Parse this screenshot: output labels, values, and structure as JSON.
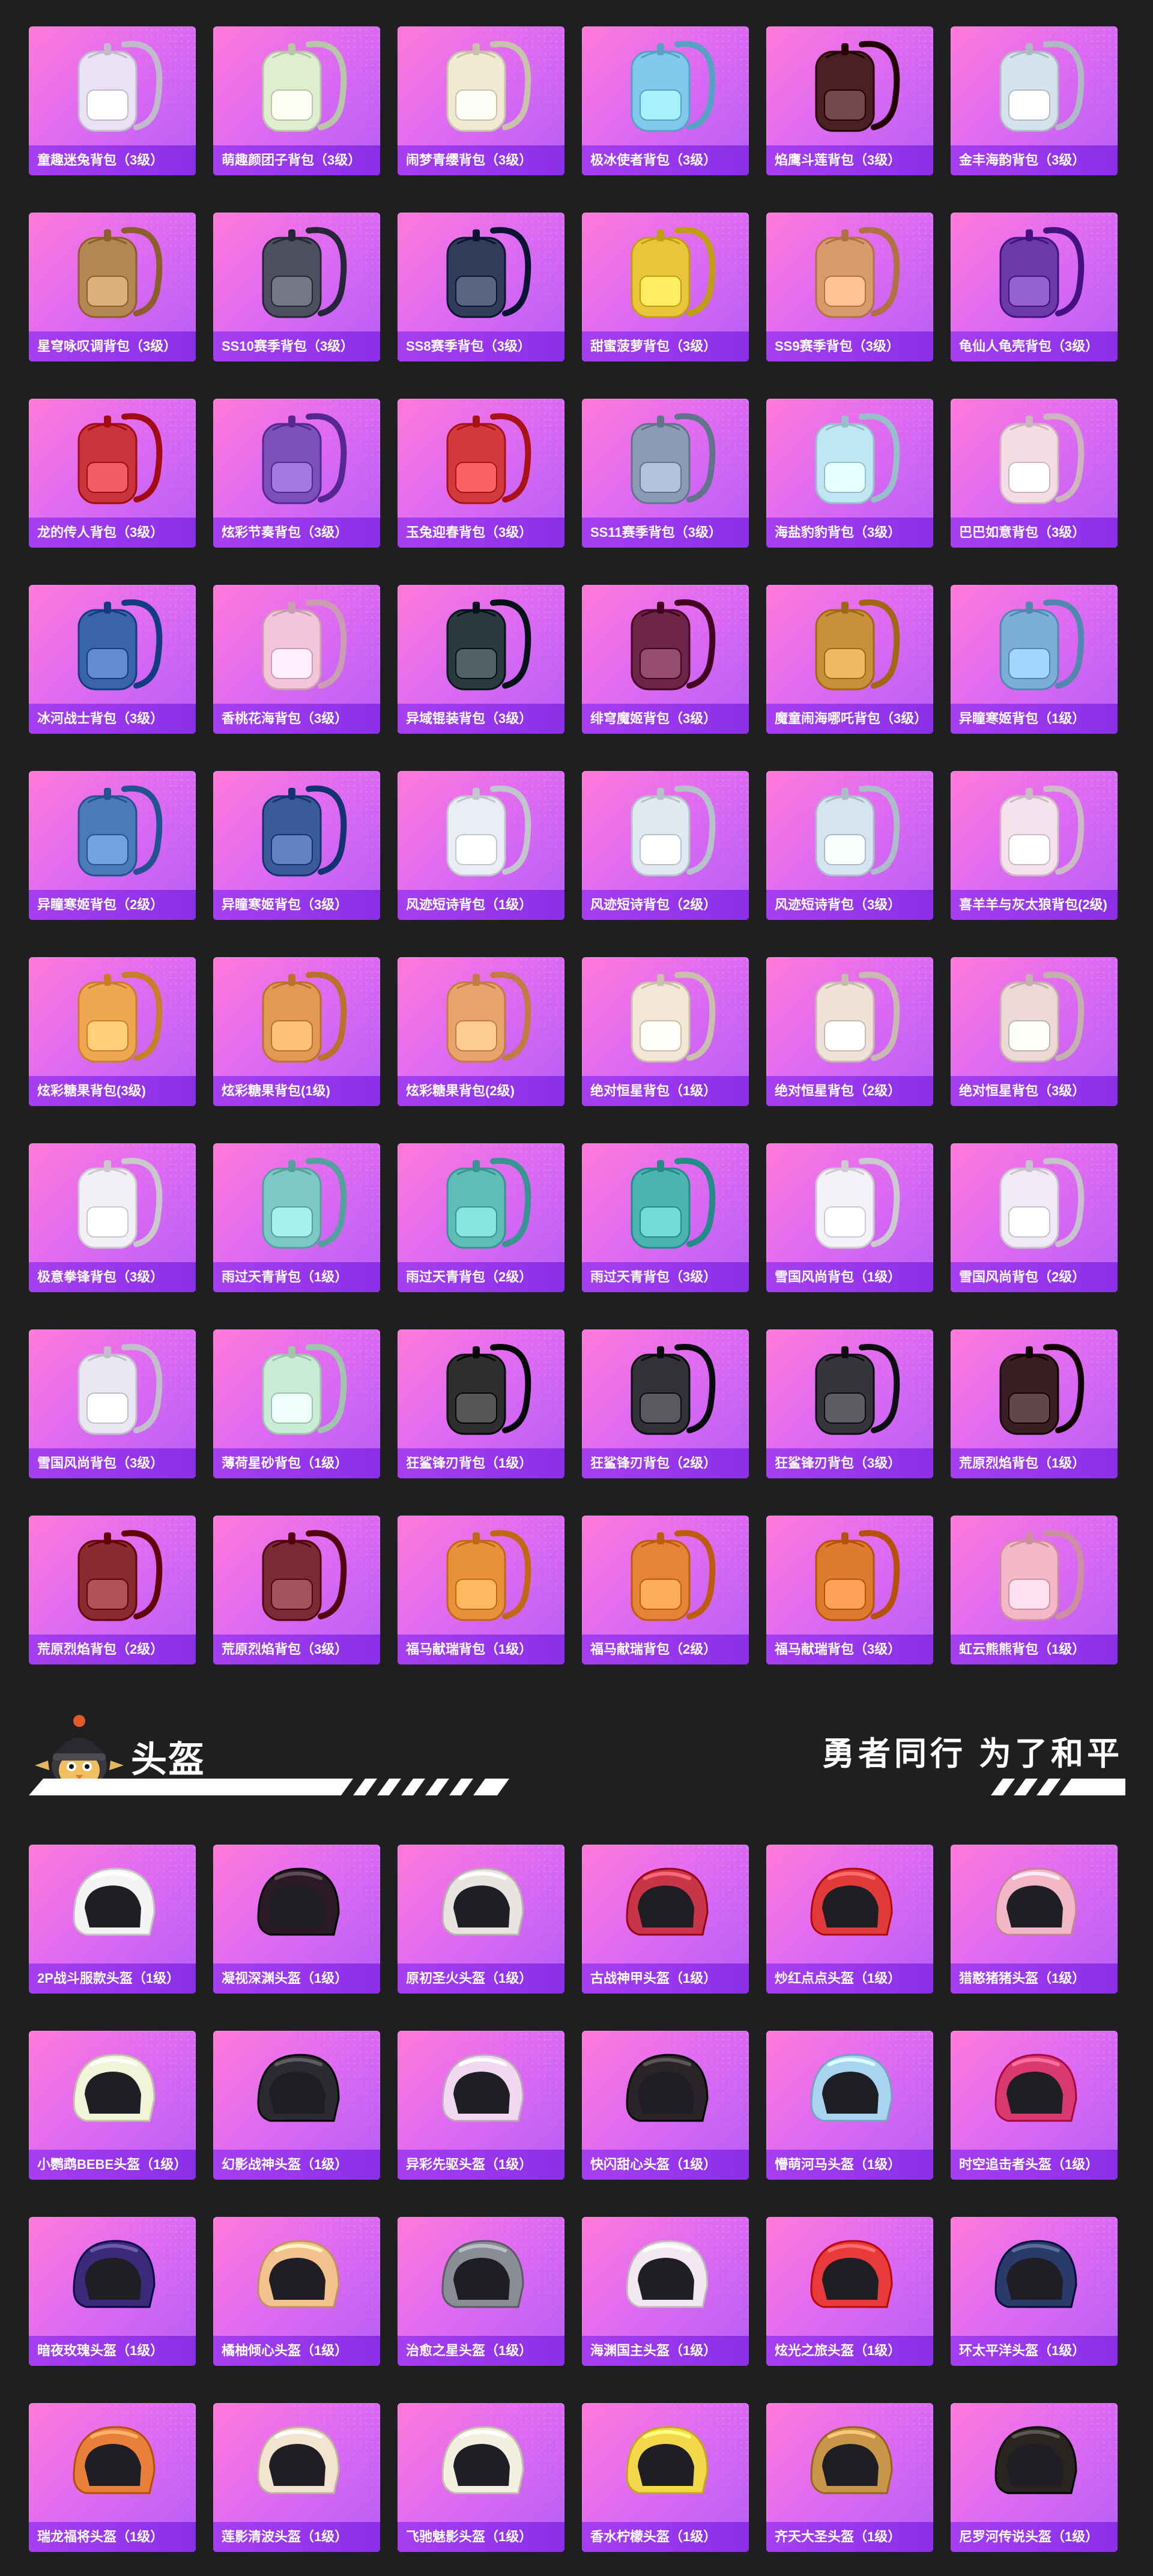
{
  "backpacks": [
    {
      "label": "童趣迷兔背包（3级）",
      "color": "#e8e2f4",
      "icon": "backpack-icon"
    },
    {
      "label": "萌趣颜团子背包（3级）",
      "color": "#dfeecf",
      "icon": "backpack-icon"
    },
    {
      "label": "闹梦青缨背包（3级）",
      "color": "#f1ead2",
      "icon": "backpack-icon"
    },
    {
      "label": "极冰使者背包（3级）",
      "color": "#7fc9ec",
      "icon": "backpack-icon"
    },
    {
      "label": "焰鹰斗莲背包（3级）",
      "color": "#4a2024",
      "icon": "backpack-icon"
    },
    {
      "label": "金丰海韵背包（3级）",
      "color": "#d7e3ec",
      "icon": "backpack-icon"
    },
    {
      "label": "星穹咏叹调背包（3级）",
      "color": "#b48654",
      "icon": "backpack-icon"
    },
    {
      "label": "SS10赛季背包（3级）",
      "color": "#4d4e60",
      "icon": "backpack-icon"
    },
    {
      "label": "SS8赛季背包（3级）",
      "color": "#303c59",
      "icon": "backpack-icon"
    },
    {
      "label": "甜蜜菠萝背包（3级）",
      "color": "#e8c63a",
      "icon": "backpack-icon"
    },
    {
      "label": "SS9赛季背包（3级）",
      "color": "#d89a6a",
      "icon": "backpack-icon"
    },
    {
      "label": "龟仙人龟壳背包（3级）",
      "color": "#6a3aa8",
      "icon": "backpack-icon"
    },
    {
      "label": "龙的传人背包（3级）",
      "color": "#c8343a",
      "icon": "backpack-icon"
    },
    {
      "label": "炫彩节奏背包（3级）",
      "color": "#7d4fb8",
      "icon": "backpack-icon"
    },
    {
      "label": "玉兔迎春背包（3级）",
      "color": "#d13b3e",
      "icon": "backpack-icon"
    },
    {
      "label": "SS11赛季背包（3级）",
      "color": "#8a9cb4",
      "icon": "backpack-icon"
    },
    {
      "label": "海盐豹豹背包（3级）",
      "color": "#bfe6f2",
      "icon": "backpack-icon"
    },
    {
      "label": "巴巴如意背包（3级）",
      "color": "#f5dde6",
      "icon": "backpack-icon"
    },
    {
      "label": "冰河战士背包（3级）",
      "color": "#3a64a8",
      "icon": "backpack-icon"
    },
    {
      "label": "香桃花海背包（3级）",
      "color": "#f2c6d8",
      "icon": "backpack-icon"
    },
    {
      "label": "异域锟装背包（3级）",
      "color": "#2b3a3e",
      "icon": "backpack-icon"
    },
    {
      "label": "绯穹魔姬背包（3级）",
      "color": "#6c2448",
      "icon": "backpack-icon"
    },
    {
      "label": "魔童闹海哪吒背包（3级）",
      "color": "#c8903a",
      "icon": "backpack-icon"
    },
    {
      "label": "异瞳寒姬背包（1级）",
      "color": "#7ab0d8",
      "icon": "backpack-icon"
    },
    {
      "label": "异瞳寒姬背包（2级）",
      "color": "#4a7bb8",
      "icon": "backpack-icon"
    },
    {
      "label": "异瞳寒姬背包（3级）",
      "color": "#3a5a98",
      "icon": "backpack-icon"
    },
    {
      "label": "风迹短诗背包（1级）",
      "color": "#e8eef4",
      "icon": "backpack-icon"
    },
    {
      "label": "风迹短诗背包（2级）",
      "color": "#dfe9f2",
      "icon": "backpack-icon"
    },
    {
      "label": "风迹短诗背包（3级）",
      "color": "#d4e4f0",
      "icon": "backpack-icon"
    },
    {
      "label": "喜羊羊与灰太狼背包(2级)",
      "color": "#f6e2ec",
      "icon": "backpack-icon"
    },
    {
      "label": "炫彩糖果背包(3级)",
      "color": "#f0a850",
      "icon": "backpack-icon"
    },
    {
      "label": "炫彩糖果背包(1级)",
      "color": "#e09a52",
      "icon": "backpack-icon"
    },
    {
      "label": "炫彩糖果背包(2级)",
      "color": "#e8a46a",
      "icon": "backpack-icon"
    },
    {
      "label": "绝对恒星背包（1级）",
      "color": "#f2e6d4",
      "icon": "backpack-icon"
    },
    {
      "label": "绝对恒星背包（2级）",
      "color": "#f0e2d8",
      "icon": "backpack-icon"
    },
    {
      "label": "绝对恒星背包（3级）",
      "color": "#ecd8d4",
      "icon": "backpack-icon"
    },
    {
      "label": "极意拳锋背包（3级）",
      "color": "#f2f0f4",
      "icon": "backpack-icon"
    },
    {
      "label": "雨过天青背包（1级）",
      "color": "#7cc8c4",
      "icon": "backpack-icon"
    },
    {
      "label": "雨过天青背包（2级）",
      "color": "#5fbcb8",
      "icon": "backpack-icon"
    },
    {
      "label": "雨过天青背包（3级）",
      "color": "#4cb4b0",
      "icon": "backpack-icon"
    },
    {
      "label": "雪国风尚背包（1级）",
      "color": "#f4f2f8",
      "icon": "backpack-icon"
    },
    {
      "label": "雪国风尚背包（2级）",
      "color": "#efeaf6",
      "icon": "backpack-icon"
    },
    {
      "label": "雪国风尚背包（3级）",
      "color": "#ebe6f4",
      "icon": "backpack-icon"
    },
    {
      "label": "薄荷星砂背包（1级）",
      "color": "#c8ecd4",
      "icon": "backpack-icon"
    },
    {
      "label": "狂鲨锋刃背包（1级）",
      "color": "#2c2e30",
      "icon": "backpack-icon"
    },
    {
      "label": "狂鲨锋刃背包（2级）",
      "color": "#303236",
      "icon": "backpack-icon"
    },
    {
      "label": "狂鲨锋刃背包（3级）",
      "color": "#34363a",
      "icon": "backpack-icon"
    },
    {
      "label": "荒原烈焰背包（1级）",
      "color": "#3a1e24",
      "icon": "backpack-icon"
    },
    {
      "label": "荒原烈焰背包（2级）",
      "color": "#8a2a30",
      "icon": "backpack-icon"
    },
    {
      "label": "荒原烈焰背包（3级）",
      "color": "#7a2a34",
      "icon": "backpack-icon"
    },
    {
      "label": "福马献瑞背包（1级）",
      "color": "#e8903a",
      "icon": "backpack-icon"
    },
    {
      "label": "福马献瑞背包（2级）",
      "color": "#e48434",
      "icon": "backpack-icon"
    },
    {
      "label": "福马献瑞背包（3级）",
      "color": "#de7a30",
      "icon": "backpack-icon"
    },
    {
      "label": "虹云熊熊背包（1级）",
      "color": "#f4b8c8",
      "icon": "backpack-icon"
    }
  ],
  "section": {
    "title": "头盔",
    "slogan": "勇者同行 为了和平",
    "mascot_icon": "helmet-mascot-icon"
  },
  "helmets": [
    {
      "label": "2P战斗服款头盔（1级）",
      "color": "#f4f4f4",
      "icon": "helmet-icon"
    },
    {
      "label": "凝视深渊头盔（1级）",
      "color": "#2a1a24",
      "icon": "helmet-icon"
    },
    {
      "label": "原初圣火头盔（1级）",
      "color": "#e8e4e0",
      "icon": "helmet-icon"
    },
    {
      "label": "古战神甲头盔（1级）",
      "color": "#c83448",
      "icon": "helmet-icon"
    },
    {
      "label": "炒红点点头盔（1级）",
      "color": "#e03a3a",
      "icon": "helmet-icon"
    },
    {
      "label": "猎憨猪猪头盔（1级）",
      "color": "#f2b8c8",
      "icon": "helmet-icon"
    },
    {
      "label": "小鹦鹉BEBE头盔（1级）",
      "color": "#f2f4d8",
      "icon": "helmet-icon"
    },
    {
      "label": "幻影战神头盔（1级）",
      "color": "#2a2a30",
      "icon": "helmet-icon"
    },
    {
      "label": "异彩先驱头盔（1级）",
      "color": "#f0d8f0",
      "icon": "helmet-icon"
    },
    {
      "label": "快闪甜心头盔（1级）",
      "color": "#2a2428",
      "icon": "helmet-icon"
    },
    {
      "label": "懵萌河马头盔（1级）",
      "color": "#a8d4f0",
      "icon": "helmet-icon"
    },
    {
      "label": "时空追击者头盔（1级）",
      "color": "#d83a70",
      "icon": "helmet-icon"
    },
    {
      "label": "暗夜玫瑰头盔（1级）",
      "color": "#3a2a78",
      "icon": "helmet-icon"
    },
    {
      "label": "橘柚倾心头盔（1级）",
      "color": "#f2c290",
      "icon": "helmet-icon"
    },
    {
      "label": "治愈之星头盔（1级）",
      "color": "#8a8c96",
      "icon": "helmet-icon"
    },
    {
      "label": "海渊国主头盔（1级）",
      "color": "#f2e8f0",
      "icon": "helmet-icon"
    },
    {
      "label": "炫光之旅头盔（1级）",
      "color": "#e83a3a",
      "icon": "helmet-icon"
    },
    {
      "label": "环太平洋头盔（1级）",
      "color": "#2a3a6a",
      "icon": "helmet-icon"
    },
    {
      "label": "瑞龙福将头盔（1级）",
      "color": "#e8803a",
      "icon": "helmet-icon"
    },
    {
      "label": "莲影清波头盔（1级）",
      "color": "#f2e4d0",
      "icon": "helmet-icon"
    },
    {
      "label": "飞驰魅影头盔（1级）",
      "color": "#f4f0e0",
      "icon": "helmet-icon"
    },
    {
      "label": "香水柠檬头盔（1级）",
      "color": "#f2d84a",
      "icon": "helmet-icon"
    },
    {
      "label": "齐天大圣头盔（1级）",
      "color": "#c8964a",
      "icon": "helmet-icon"
    },
    {
      "label": "尼罗河传说头盔（1级）",
      "color": "#2a2420",
      "icon": "helmet-icon"
    }
  ]
}
